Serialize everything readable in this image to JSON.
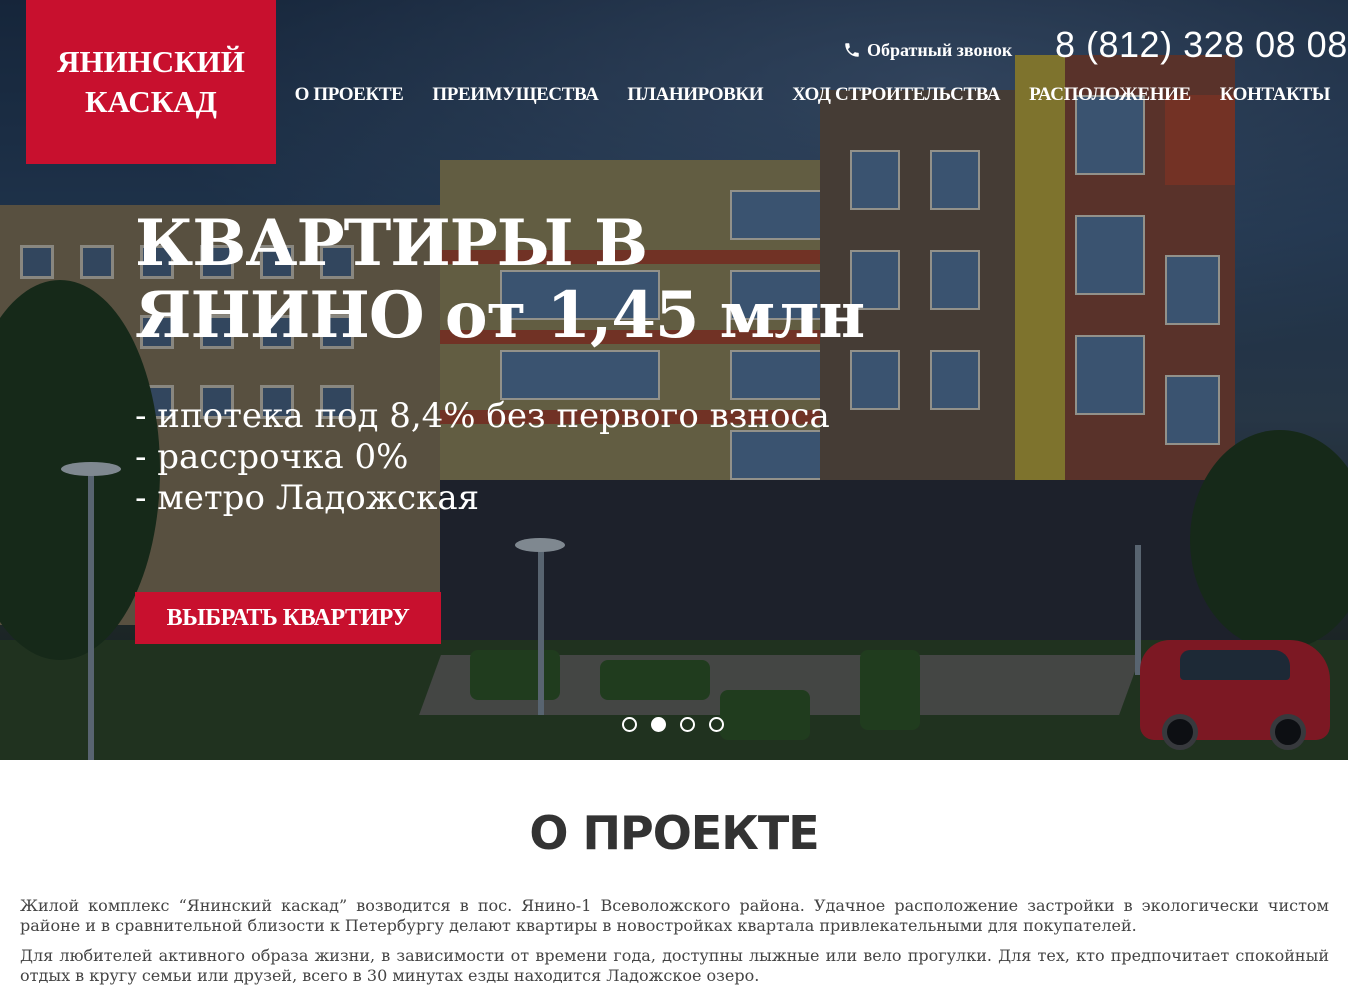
{
  "brand": {
    "logo_line1": "ЯНИНСКИЙ",
    "logo_line2": "КАСКАД",
    "accent_color": "#c8102e"
  },
  "header": {
    "callback_label": "Обратный звонок",
    "callback_icon": "phone-icon",
    "phone": "8 (812) 328 08 08"
  },
  "nav": {
    "items": [
      {
        "label": "О ПРОЕКТЕ"
      },
      {
        "label": "ПРЕИМУЩЕСТВА"
      },
      {
        "label": "ПЛАНИРОВКИ"
      },
      {
        "label": "ХОД СТРОИТЕЛЬСТВА"
      },
      {
        "label": "РАСПОЛОЖЕНИЕ"
      },
      {
        "label": "КОНТАКТЫ"
      }
    ]
  },
  "hero": {
    "headline_line1": "КВАРТИРЫ В",
    "headline_line2_a": "ЯНИНО ",
    "headline_line2_b": "от 1,45 млн",
    "bullets": [
      "- ипотека под 8,4% без первого взноса",
      "- рассрочка 0%",
      "- метро Ладожская"
    ],
    "cta_label": "ВЫБРАТЬ КВАРТИРУ",
    "slides_total": 4,
    "active_slide": 2
  },
  "about": {
    "title": "О ПРОЕКТЕ",
    "paragraph1": "Жилой комплекс “Янинский каскад” возводится в пос. Янино-1 Всеволожского района. Удачное расположение застройки в экологически чистом районе и в сравнительной близости к Петербургу делают квартиры в новостройках квартала привлекательными для покупателей.",
    "paragraph2": "Для любителей активного образа жизни, в зависимости от времени года, доступны лыжные или вело прогулки. Для тех, кто предпочитает спокойный отдых в кругу семьи или друзей, всего в 30 минутах езды находится Ладожское озеро."
  }
}
